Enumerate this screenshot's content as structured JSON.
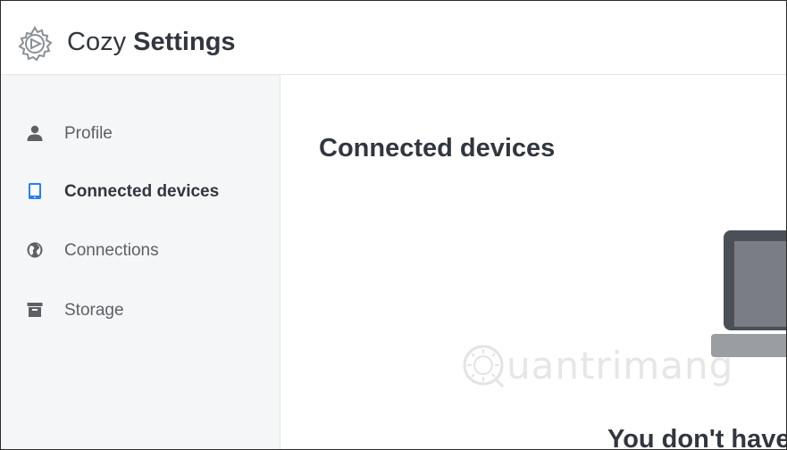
{
  "header": {
    "app_name_light": "Cozy",
    "app_name_bold": "Settings",
    "logo_icon": "gear-icon"
  },
  "sidebar": {
    "items": [
      {
        "label": "Profile",
        "icon": "user-icon",
        "active": false
      },
      {
        "label": "Connected devices",
        "icon": "tablet-icon",
        "active": true
      },
      {
        "label": "Connections",
        "icon": "globe-icon",
        "active": false
      },
      {
        "label": "Storage",
        "icon": "archive-icon",
        "active": false
      }
    ]
  },
  "main": {
    "title": "Connected devices",
    "empty_message": "You don't have",
    "illustration": "laptop-illustration"
  },
  "watermark": {
    "text": "uantrimang",
    "icon": "watermark-logo-icon"
  },
  "colors": {
    "accent": "#297ef2",
    "text_dark": "#32363f",
    "text_muted": "#5d6165",
    "sidebar_bg": "#f5f6f7",
    "icon_grey": "#5d6165"
  }
}
